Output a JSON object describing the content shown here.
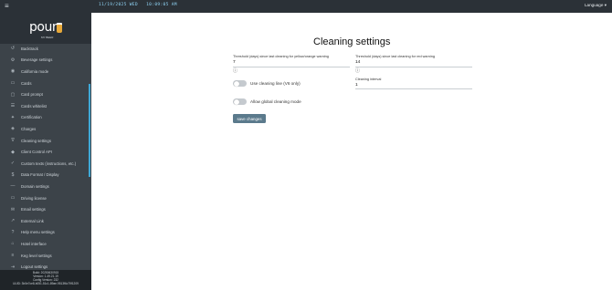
{
  "topbar": {
    "menu_icon": "hamburger-icon",
    "clock": "11/19/2025 WED   10:09:05 AM",
    "language_label": "Language"
  },
  "sidebar": {
    "logo_text": "pour",
    "logo_sub": "MY BEER",
    "items": [
      {
        "label": "Backtrack",
        "icon": "history-icon"
      },
      {
        "label": "Beverage settings",
        "icon": "gear-icon"
      },
      {
        "label": "California mode",
        "icon": "bear-icon"
      },
      {
        "label": "Cards",
        "icon": "card-icon"
      },
      {
        "label": "Card prompt",
        "icon": "prompt-icon"
      },
      {
        "label": "Cards whitelist",
        "icon": "list-icon"
      },
      {
        "label": "Certification",
        "icon": "certificate-icon"
      },
      {
        "label": "Charges",
        "icon": "charge-icon"
      },
      {
        "label": "Cleaning settings",
        "icon": "cleaning-icon"
      },
      {
        "label": "Client Control API",
        "icon": "api-icon"
      },
      {
        "label": "Custom texts (instructions, etc.)",
        "icon": "text-icon"
      },
      {
        "label": "Data Format / Display",
        "icon": "dollar-icon"
      },
      {
        "label": "Domain settings",
        "icon": "domain-icon"
      },
      {
        "label": "Driving license",
        "icon": "license-icon"
      },
      {
        "label": "Email settings",
        "icon": "email-icon"
      },
      {
        "label": "External Link",
        "icon": "link-icon"
      },
      {
        "label": "Help menu settings",
        "icon": "help-icon"
      },
      {
        "label": "Hotel interface",
        "icon": "hotel-icon"
      },
      {
        "label": "Keg level settings",
        "icon": "keg-icon"
      },
      {
        "label": "Logout settings",
        "icon": "logout-icon"
      }
    ],
    "footer": {
      "build": "Build: 20250630915",
      "version": "Version: 1.49.21.19",
      "config": "Config Version: 232",
      "uuid": "UUID: 3b0e7ce8-b051-51c1-89ae-9513f6c79f1209"
    }
  },
  "main": {
    "title": "Cleaning settings",
    "field_yellow_label": "Threshold (days) since last cleaning for yellow/orange warning",
    "field_yellow_value": "7",
    "field_red_label": "Threshold (days) since last cleaning for red warning",
    "field_red_value": "14",
    "field_interval_label": "Cleaning interval",
    "field_interval_value": "1",
    "toggle_cleaning_line_label": "Use cleaning line (V6 only)",
    "toggle_global_label": "Allow global cleaning mode",
    "save_label": "save changes"
  },
  "colors": {
    "topbar": "#2b3137",
    "sidebar": "#3c4349",
    "accent": "#3fa9d8",
    "button": "#5b7a8c"
  }
}
